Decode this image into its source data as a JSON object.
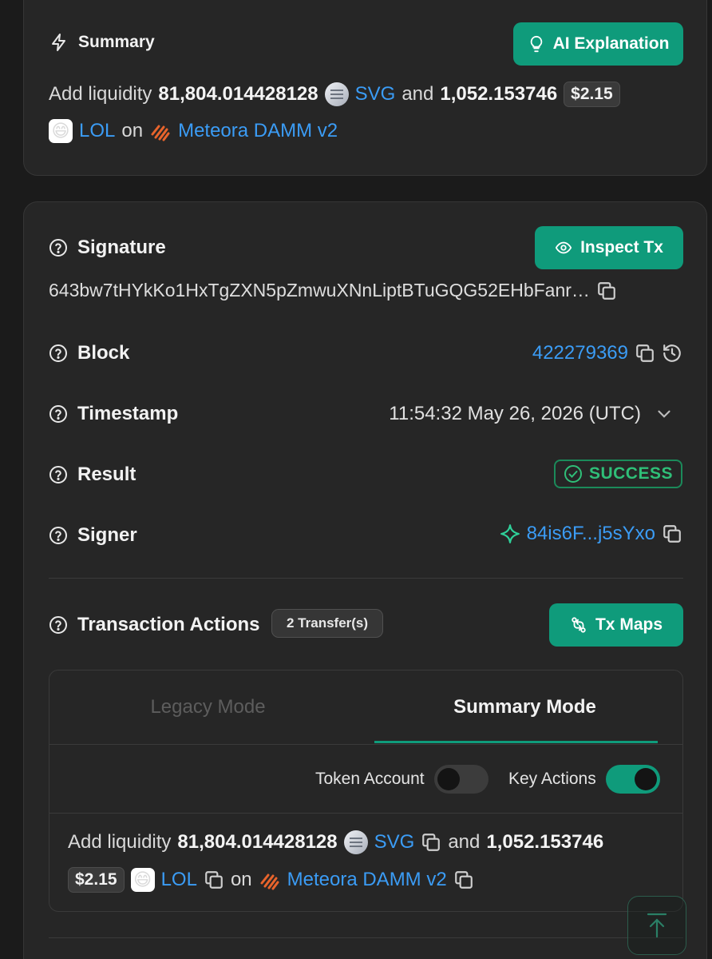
{
  "summary": {
    "title": "Summary",
    "ai_button": "AI Explanation",
    "desc": {
      "verb": "Add liquidity",
      "amount1": "81,804.014428128",
      "token1": "SVG",
      "conj": "and",
      "amount2": "1,052.153746",
      "usd": "$2.15",
      "token2": "LOL",
      "on": "on",
      "platform": "Meteora DAMM v2"
    }
  },
  "details": {
    "signature_label": "Signature",
    "inspect_button": "Inspect Tx",
    "signature_value": "643bw7tHYkKo1HxTgZXN5pZmwuXNnLiptBTuGQG52EHbFanr…",
    "block_label": "Block",
    "block_value": "422279369",
    "timestamp_label": "Timestamp",
    "timestamp_value": "11:54:32 May 26, 2026 (UTC)",
    "result_label": "Result",
    "result_value": "SUCCESS",
    "signer_label": "Signer",
    "signer_value": "84is6F...j5sYxo"
  },
  "actions": {
    "label": "Transaction Actions",
    "badge": "2 Transfer(s)",
    "maps_button": "Tx Maps",
    "tabs": [
      "Legacy Mode",
      "Summary Mode"
    ],
    "toggle_token_account": "Token Account",
    "toggle_key_actions": "Key Actions",
    "desc": {
      "verb": "Add liquidity",
      "amount1": "81,804.014428128",
      "token1": "SVG",
      "conj": "and",
      "amount2": "1,052.153746",
      "usd": "$2.15",
      "token2": "LOL",
      "on": "on",
      "platform": "Meteora DAMM v2"
    }
  },
  "colors": {
    "accent": "#0f9b7b",
    "link": "#3b9cf5",
    "success": "#2fbf78",
    "background": "#1b1b1b",
    "card": "#262626"
  },
  "icons": [
    "lightning-icon",
    "lightbulb-icon",
    "eye-icon",
    "help-circle-icon",
    "copy-icon",
    "history-icon",
    "chevron-down-icon",
    "check-circle-icon",
    "sparkle-icon",
    "route-icon",
    "arrow-up-icon"
  ]
}
